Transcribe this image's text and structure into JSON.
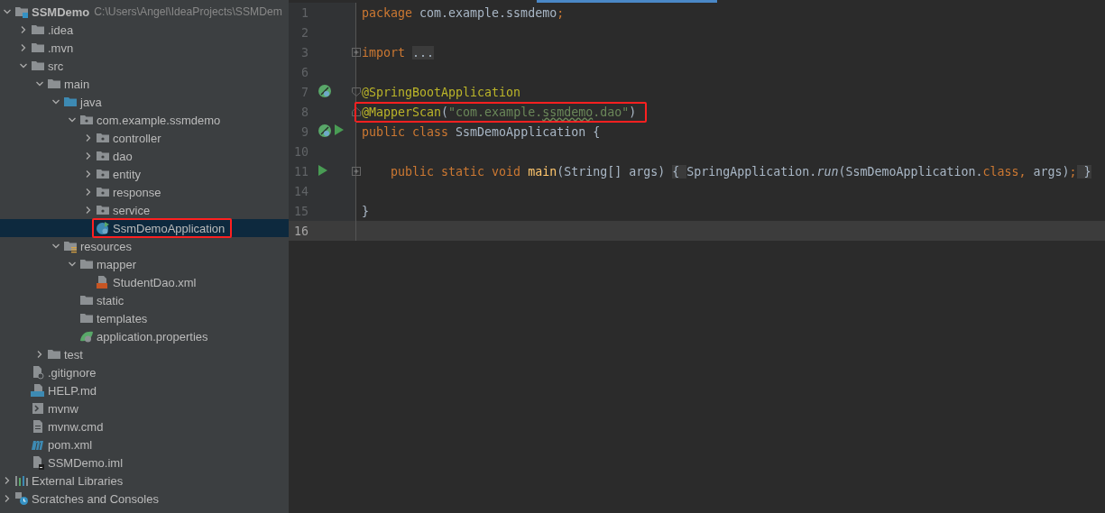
{
  "project_tree": [
    {
      "label": "SSMDemo",
      "kind": "module",
      "path": "C:\\Users\\Angel\\IdeaProjects\\SSMDem",
      "expanded": true,
      "selected": false,
      "children": [
        {
          "label": ".idea",
          "kind": "folder",
          "expanded": false,
          "selected": false
        },
        {
          "label": ".mvn",
          "kind": "folder",
          "expanded": false,
          "selected": false
        },
        {
          "label": "src",
          "kind": "folder",
          "expanded": true,
          "selected": false,
          "children": [
            {
              "label": "main",
              "kind": "folder",
              "expanded": true,
              "selected": false,
              "children": [
                {
                  "label": "java",
                  "kind": "source",
                  "expanded": true,
                  "selected": false,
                  "children": [
                    {
                      "label": "com.example.ssmdemo",
                      "kind": "package",
                      "expanded": true,
                      "selected": false,
                      "children": [
                        {
                          "label": "controller",
                          "kind": "package",
                          "expanded": false,
                          "selected": false
                        },
                        {
                          "label": "dao",
                          "kind": "package",
                          "expanded": false,
                          "selected": false
                        },
                        {
                          "label": "entity",
                          "kind": "package",
                          "expanded": false,
                          "selected": false
                        },
                        {
                          "label": "response",
                          "kind": "package",
                          "expanded": false,
                          "selected": false
                        },
                        {
                          "label": "service",
                          "kind": "package",
                          "expanded": false,
                          "selected": false
                        },
                        {
                          "label": "SsmDemoApplication",
                          "kind": "class",
                          "selected": true,
                          "annotated": true
                        }
                      ]
                    }
                  ]
                },
                {
                  "label": "resources",
                  "kind": "resources",
                  "expanded": true,
                  "selected": false,
                  "children": [
                    {
                      "label": "mapper",
                      "kind": "folder",
                      "expanded": true,
                      "selected": false,
                      "children": [
                        {
                          "label": "StudentDao.xml",
                          "kind": "xml",
                          "selected": false
                        }
                      ]
                    },
                    {
                      "label": "static",
                      "kind": "folder",
                      "selected": false
                    },
                    {
                      "label": "templates",
                      "kind": "folder",
                      "selected": false
                    },
                    {
                      "label": "application.properties",
                      "kind": "properties",
                      "selected": false
                    }
                  ]
                }
              ]
            },
            {
              "label": "test",
              "kind": "folder",
              "expanded": false,
              "selected": false
            }
          ]
        },
        {
          "label": ".gitignore",
          "kind": "ignore",
          "selected": false
        },
        {
          "label": "HELP.md",
          "kind": "markdown",
          "selected": false
        },
        {
          "label": "mvnw",
          "kind": "script",
          "selected": false
        },
        {
          "label": "mvnw.cmd",
          "kind": "text",
          "selected": false
        },
        {
          "label": "pom.xml",
          "kind": "maven",
          "selected": false
        },
        {
          "label": "SSMDemo.iml",
          "kind": "iml",
          "selected": false
        }
      ]
    },
    {
      "label": "External Libraries",
      "kind": "libraries",
      "expanded": false,
      "selected": false
    },
    {
      "label": "Scratches and Consoles",
      "kind": "scratches",
      "expanded": false,
      "selected": false
    }
  ],
  "editor": {
    "lines": [
      {
        "number": "1",
        "current": false,
        "tokens": [
          {
            "text": "package ",
            "kind": "keyword"
          },
          {
            "text": "com.example.ssmdemo",
            "kind": "plain"
          },
          {
            "text": ";",
            "kind": "keyword"
          }
        ]
      },
      {
        "number": "2",
        "current": false
      },
      {
        "number": "3",
        "current": false,
        "fold_collapsed": true,
        "tokens": [
          {
            "text": "import ",
            "kind": "keyword"
          },
          {
            "text": "...",
            "kind": "fold"
          }
        ]
      },
      {
        "number": "6",
        "current": false
      },
      {
        "number": "7",
        "current": false,
        "fold_start": true,
        "bean_icon": true,
        "tokens": [
          {
            "text": "@SpringBootApplication",
            "kind": "annotation"
          }
        ]
      },
      {
        "number": "8",
        "current": false,
        "annotated": true,
        "fold_end": true,
        "tokens": [
          {
            "text": "@MapperScan",
            "kind": "annotation"
          },
          {
            "text": "(",
            "kind": "plain"
          },
          {
            "text": "\"com.example.",
            "kind": "string"
          },
          {
            "text": "ssmdemo",
            "kind": "typo"
          },
          {
            "text": ".dao\"",
            "kind": "string"
          },
          {
            "text": ")",
            "kind": "plain"
          }
        ]
      },
      {
        "number": "9",
        "current": false,
        "bean_icon": true,
        "run_icon": true,
        "tokens": [
          {
            "text": "public class ",
            "kind": "keyword"
          },
          {
            "text": "SsmDemoApplication {",
            "kind": "plain"
          }
        ]
      },
      {
        "number": "10",
        "current": false
      },
      {
        "number": "11",
        "current": false,
        "fold_collapsed": true,
        "run_icon": true,
        "tokens": [
          {
            "text": "    public static void ",
            "kind": "keyword"
          },
          {
            "text": "main",
            "kind": "method"
          },
          {
            "text": "(String[] args) ",
            "kind": "plain"
          },
          {
            "text": "{ ",
            "kind": "fold"
          },
          {
            "text": "SpringApplication.",
            "kind": "plain"
          },
          {
            "text": "run",
            "kind": "italic"
          },
          {
            "text": "(SsmDemoApplication.",
            "kind": "plain"
          },
          {
            "text": "class, ",
            "kind": "keyword"
          },
          {
            "text": "args)",
            "kind": "plain"
          },
          {
            "text": ";",
            "kind": "keyword"
          },
          {
            "text": " }",
            "kind": "fold"
          }
        ]
      },
      {
        "number": "14",
        "current": false
      },
      {
        "number": "15",
        "current": false,
        "tokens": [
          {
            "text": "}",
            "kind": "plain"
          }
        ]
      },
      {
        "number": "16",
        "current": true
      }
    ]
  }
}
